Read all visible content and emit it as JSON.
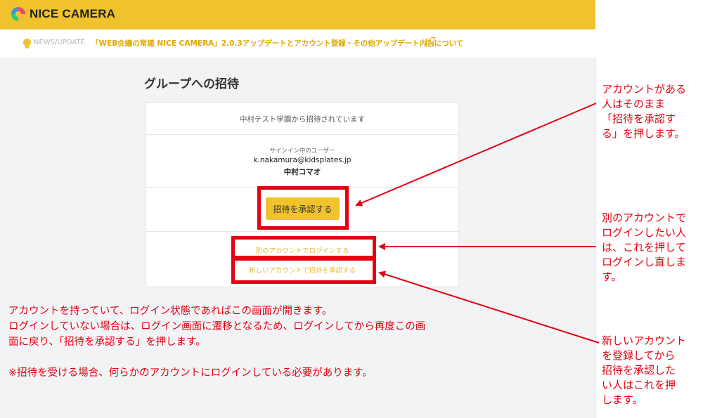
{
  "app": {
    "brand": "NICE CAMERA",
    "news_label": "NEWS/UPDATE",
    "news_text": "「WEB会議の常識 NICE CAMERA」2.0.3アップデートとアカウント登録・その他アップデート内容について",
    "page_title": "グループへの招待"
  },
  "card": {
    "invite_message": "中村テスト学園から招待されています",
    "signin_label": "サインイン中のユーザー",
    "signin_email": "k.nakamura@kidsplates.jp",
    "signin_name": "中村コマオ",
    "approve_button": "招待を承認する",
    "other_account_link": "別のアカウントでログインする",
    "new_account_link": "新しいアカウントで招待を承認する"
  },
  "annotations": {
    "approve_note": [
      "アカウントがある",
      "人はそのまま",
      "「招待を承認す",
      "る」を押します。"
    ],
    "other_account_note": [
      "別のアカウントで",
      "ログインしたい人",
      "は、これを押して",
      "ログインし直しま",
      "す。"
    ],
    "new_account_note": [
      "新しいアカウント",
      "を登録してから",
      "招待を承認した",
      "い人はこれを押",
      "します。"
    ],
    "bottom_note": [
      "アカウントを持っていて、ログイン状態であればこの画面が開きます。",
      "ログインしていない場合は、ログイン画面に遷移となるため、ログインしてから再度この画",
      "面に戻り、「招待を承認する」を押します。",
      "",
      "※招待を受ける場合、何らかのアカウントにログインしている必要があります。"
    ]
  },
  "colors": {
    "brand_yellow": "#f0c22b",
    "annotation_red": "#e60012",
    "link_yellow": "#e8b93a"
  },
  "icons": {
    "logo": "camera-logo-icon",
    "news": "lightbulb-icon",
    "external": "external-link-icon"
  }
}
